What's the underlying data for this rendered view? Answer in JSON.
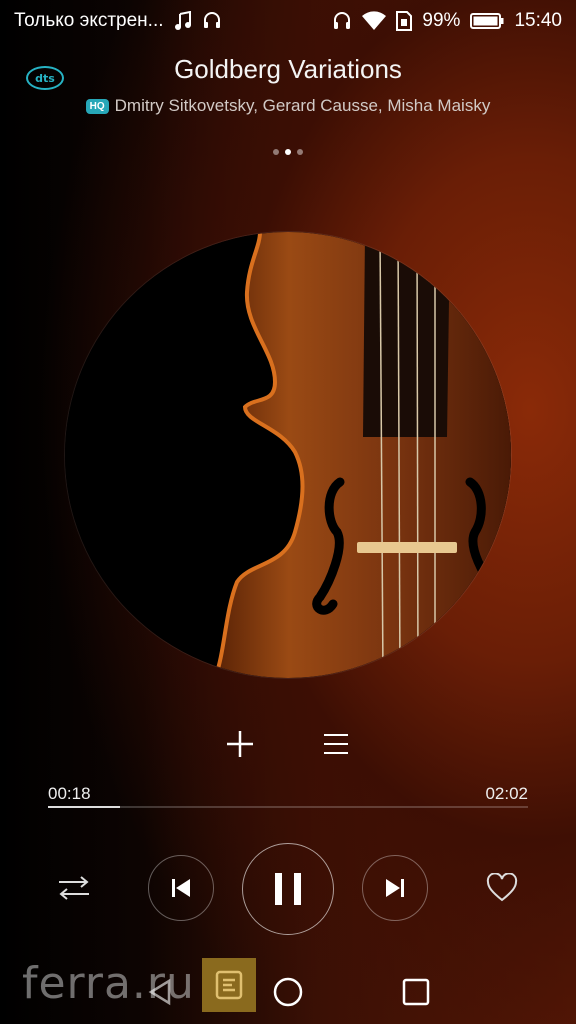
{
  "status_bar": {
    "notification_text": "Только экстрен...",
    "battery": "99%",
    "time": "15:40",
    "icons": [
      "music-note-icon",
      "headset-icon",
      "headphones-icon",
      "wifi-icon",
      "sim-icon",
      "battery-icon"
    ]
  },
  "header": {
    "dts_label": "dts",
    "title": "Goldberg Variations",
    "hq_badge": "HQ",
    "artists": "Dmitry Sitkovetsky, Gerard Causse, Misha Maisky",
    "page_count": 3,
    "page_active": 2
  },
  "player": {
    "elapsed": "00:18",
    "total": "02:02",
    "progress": 0.15,
    "state": "playing"
  },
  "watermark": {
    "text": "ferra.ru"
  },
  "colors": {
    "accent": "#27b3c4",
    "background_warm": "#6a1e06",
    "background_dark": "#000000"
  }
}
